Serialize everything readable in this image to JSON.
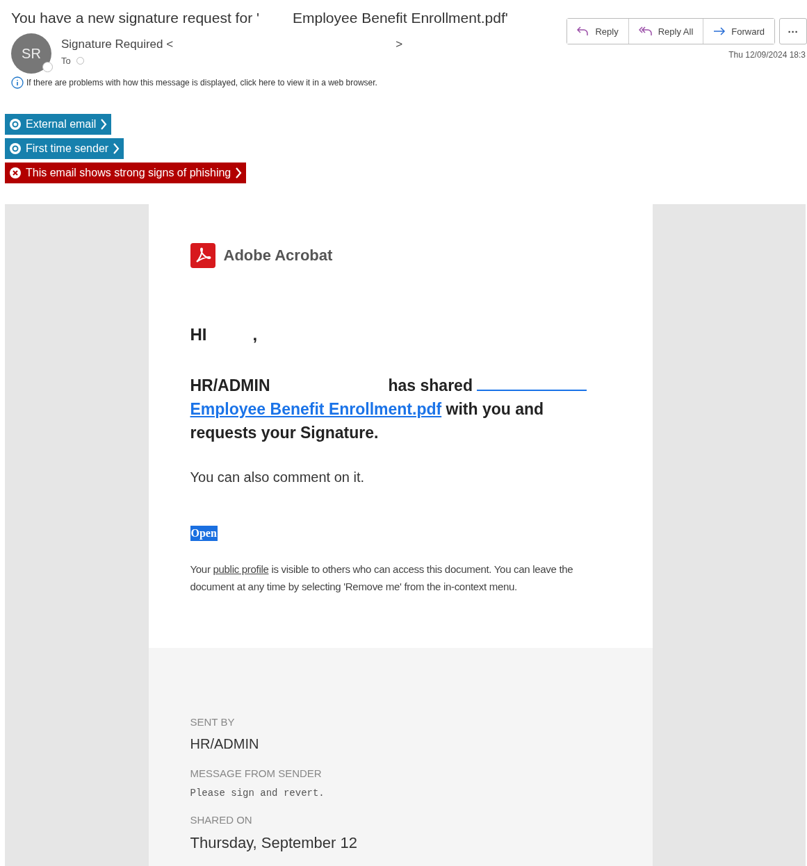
{
  "subject": {
    "before": "You have a new signature request for '",
    "after": "Employee Benefit Enrollment.pdf'"
  },
  "sender": {
    "avatar": "SR",
    "name": "Signature Required <",
    "name_end": ">",
    "to_label": "To"
  },
  "actions": [
    {
      "kind": "reply",
      "label": "Reply"
    },
    {
      "kind": "reply-all",
      "label": "Reply All"
    },
    {
      "kind": "forward",
      "label": "Forward"
    },
    {
      "kind": "more",
      "label": "···"
    }
  ],
  "date": "Thu 12/09/2024 18:3",
  "info_bar": "If there are problems with how this message is displayed, click here to view it in a web browser.",
  "tags": [
    {
      "kind": "info",
      "label": "External email"
    },
    {
      "kind": "info",
      "label": "First time sender"
    },
    {
      "kind": "danger",
      "label": "This email shows strong signs of phishing"
    }
  ],
  "email": {
    "brand": "Adobe Acrobat",
    "greeting": "HI",
    "greeting_end": ",",
    "share": {
      "before": "HR/ADMIN",
      "middle": "has shared",
      "link": "Employee Benefit Enrollment.pdf",
      "after": "with you and requests your Signature."
    },
    "comment_note": "You can also comment on it.",
    "open_button": "Open",
    "privacy": {
      "before": "Your",
      "link": "public profile",
      "after": "is visible to others who can access this document. You can leave the document at any time by selecting 'Remove me' from the in-context menu."
    },
    "footer": [
      {
        "kind": "name",
        "label": "SENT BY",
        "value": "HR/ADMIN"
      },
      {
        "kind": "mono",
        "label": "MESSAGE FROM SENDER",
        "value": "Please sign and revert."
      },
      {
        "kind": "date",
        "label": "SHARED ON",
        "value": "Thursday, September 12"
      }
    ]
  }
}
